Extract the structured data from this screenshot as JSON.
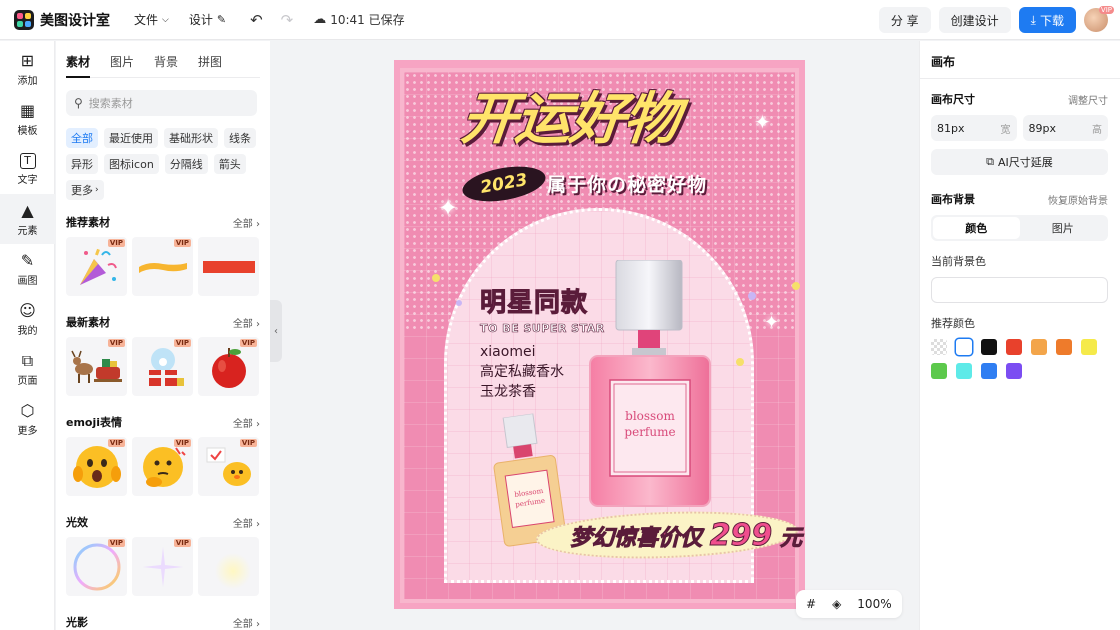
{
  "app": {
    "name": "美图设计室"
  },
  "topbar": {
    "menu": [
      {
        "label": "文件",
        "icon": "chevron-down-icon"
      },
      {
        "label": "设计",
        "icon": "edit-icon"
      }
    ],
    "save_state": "10:41 已保存",
    "share_label": "分 享",
    "create_label": "创建设计",
    "download_label": "下载",
    "avatar_badge": "VIP"
  },
  "rail": {
    "items": [
      {
        "label": "添加",
        "icon": "plus-square-icon"
      },
      {
        "label": "模板",
        "icon": "template-icon"
      },
      {
        "label": "文字",
        "icon": "text-icon"
      },
      {
        "label": "元素",
        "icon": "shapes-icon"
      },
      {
        "label": "画图",
        "icon": "draw-icon"
      },
      {
        "label": "我的",
        "icon": "user-icon"
      },
      {
        "label": "页面",
        "icon": "page-add-icon"
      },
      {
        "label": "更多",
        "icon": "cube-icon"
      }
    ],
    "active": "元素"
  },
  "material_panel": {
    "tabs": [
      "素材",
      "图片",
      "背景",
      "拼图"
    ],
    "active_tab": "素材",
    "search_placeholder": "搜索素材",
    "chips": [
      "全部",
      "最近使用",
      "基础形状",
      "线条",
      "异形",
      "图标icon",
      "分隔线",
      "箭头",
      "更多"
    ],
    "active_chip": "全部",
    "sections": [
      {
        "title": "推荐素材",
        "more": "全部"
      },
      {
        "title": "最新素材",
        "more": "全部"
      },
      {
        "title": "emoji表情",
        "more": "全部"
      },
      {
        "title": "光效",
        "more": "全部"
      },
      {
        "title": "光影",
        "more": "全部"
      }
    ],
    "vip_label": "VIP"
  },
  "poster": {
    "headline": "开运好物",
    "year": "2023",
    "subline": "属于你の秘密好物",
    "tag": "明星同款",
    "english": "TO BE SUPER STAR",
    "copy_lines": [
      "xiaomei",
      "高定私藏香水",
      "玉龙茶香"
    ],
    "bottle_label_1": "blossom",
    "bottle_label_2": "perfume",
    "price_prefix": "梦幻惊喜价仅",
    "price_value": "299",
    "price_suffix": "元"
  },
  "canvas_tools": {
    "zoom": "100%"
  },
  "right_panel": {
    "title": "画布",
    "size_label": "画布尺寸",
    "adjust_label": "调整尺寸",
    "width_value": "81px",
    "width_unit": "宽",
    "height_value": "89px",
    "height_unit": "高",
    "ai_button": "AI尺寸延展",
    "bg_label": "画布背景",
    "restore_label": "恢复原始背景",
    "seg_color": "颜色",
    "seg_image": "图片",
    "current_bg_label": "当前背景色",
    "recommended_label": "推荐颜色",
    "swatches": [
      "transparent",
      "#ffffff",
      "#111111",
      "#e8412c",
      "#f3a54a",
      "#ee7b2b",
      "#f5ea4a",
      "#5cc94c",
      "#5eeae8",
      "#2f7ef2",
      "#7b4df2"
    ]
  },
  "colors": {
    "accent": "#1e7bf2",
    "poster_pink": "#f08cb2",
    "headline_yellow": "#ffe46a"
  }
}
